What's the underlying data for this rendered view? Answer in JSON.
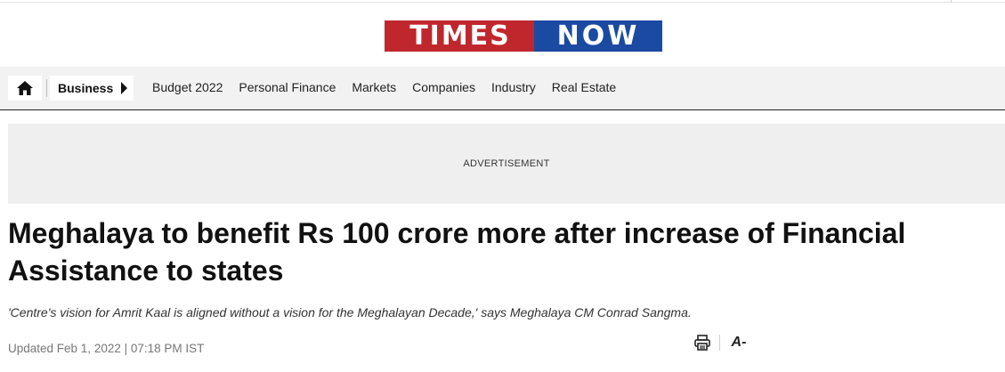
{
  "logo": {
    "left_text": "TIMES",
    "right_text": "NOW",
    "left_color": "#c0272d",
    "right_color": "#1b4aa3"
  },
  "nav": {
    "home_icon": "home-icon",
    "section": "Business",
    "links": [
      "Budget 2022",
      "Personal Finance",
      "Markets",
      "Companies",
      "Industry",
      "Real Estate"
    ]
  },
  "ad": {
    "label": "ADVERTISEMENT"
  },
  "article": {
    "headline": "Meghalaya to benefit Rs 100 crore more after increase of Financial Assistance to states",
    "summary": "'Centre's vision for Amrit Kaal is aligned without a vision for the Meghalayan Decade,' says Meghalaya CM Conrad Sangma.",
    "updated": "Updated Feb 1, 2022 | 07:18 PM IST"
  },
  "tools": {
    "print_icon": "print-icon",
    "font_size_glyph": "A-"
  }
}
